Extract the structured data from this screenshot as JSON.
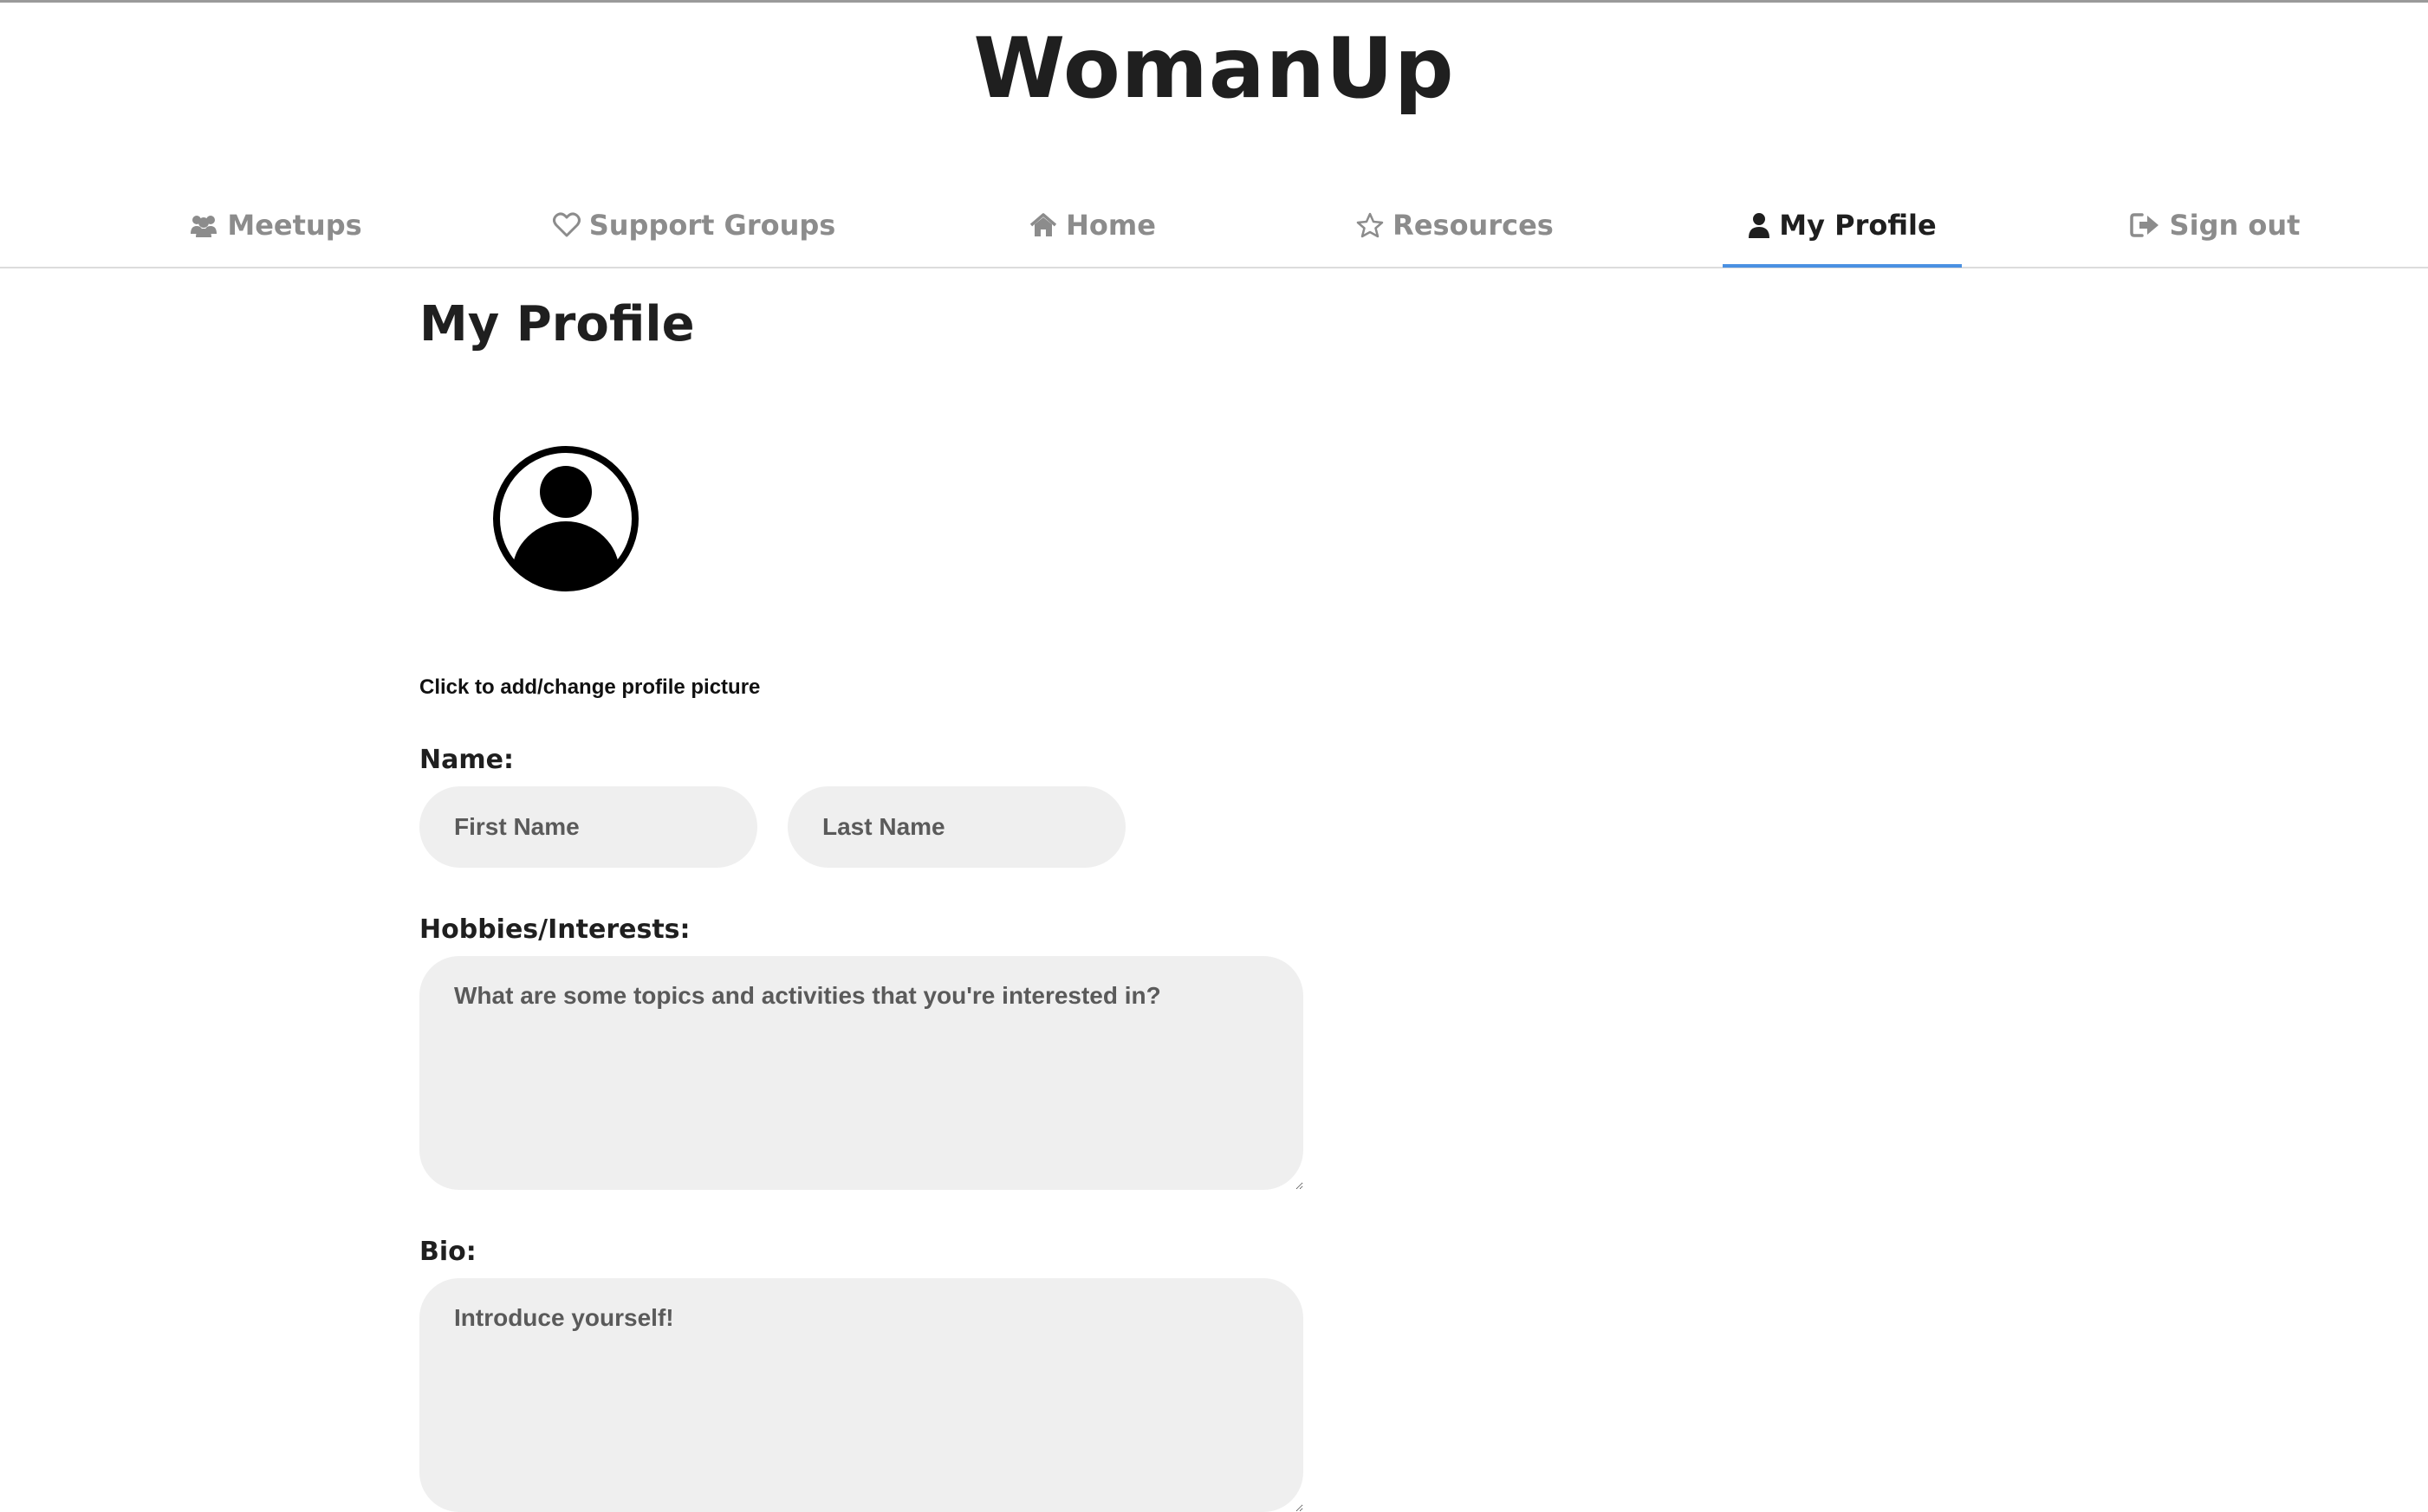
{
  "app": {
    "brand": "WomanUp"
  },
  "nav": {
    "items": [
      {
        "label": "Meetups",
        "icon": "users-icon",
        "active": false
      },
      {
        "label": "Support Groups",
        "icon": "heart-icon",
        "active": false
      },
      {
        "label": "Home",
        "icon": "home-icon",
        "active": false
      },
      {
        "label": "Resources",
        "icon": "star-icon",
        "active": false
      },
      {
        "label": "My Profile",
        "icon": "user-icon",
        "active": true
      },
      {
        "label": "Sign out",
        "icon": "sign-out-icon",
        "active": false
      }
    ]
  },
  "main": {
    "title": "My Profile",
    "avatar_icon": "user-circle-icon",
    "avatar_caption": "Click to add/change profile picture",
    "name_label": "Name:",
    "first_name_placeholder": "First Name",
    "last_name_placeholder": "Last Name",
    "hobbies_label": "Hobbies/Interests:",
    "hobbies_placeholder": "What are some topics and activities that you're interested in?",
    "bio_label": "Bio:",
    "bio_placeholder": "Introduce yourself!"
  },
  "colors": {
    "active_underline": "#4a90e2",
    "nav_inactive": "#8c8c8c",
    "field_background": "#efefef"
  }
}
